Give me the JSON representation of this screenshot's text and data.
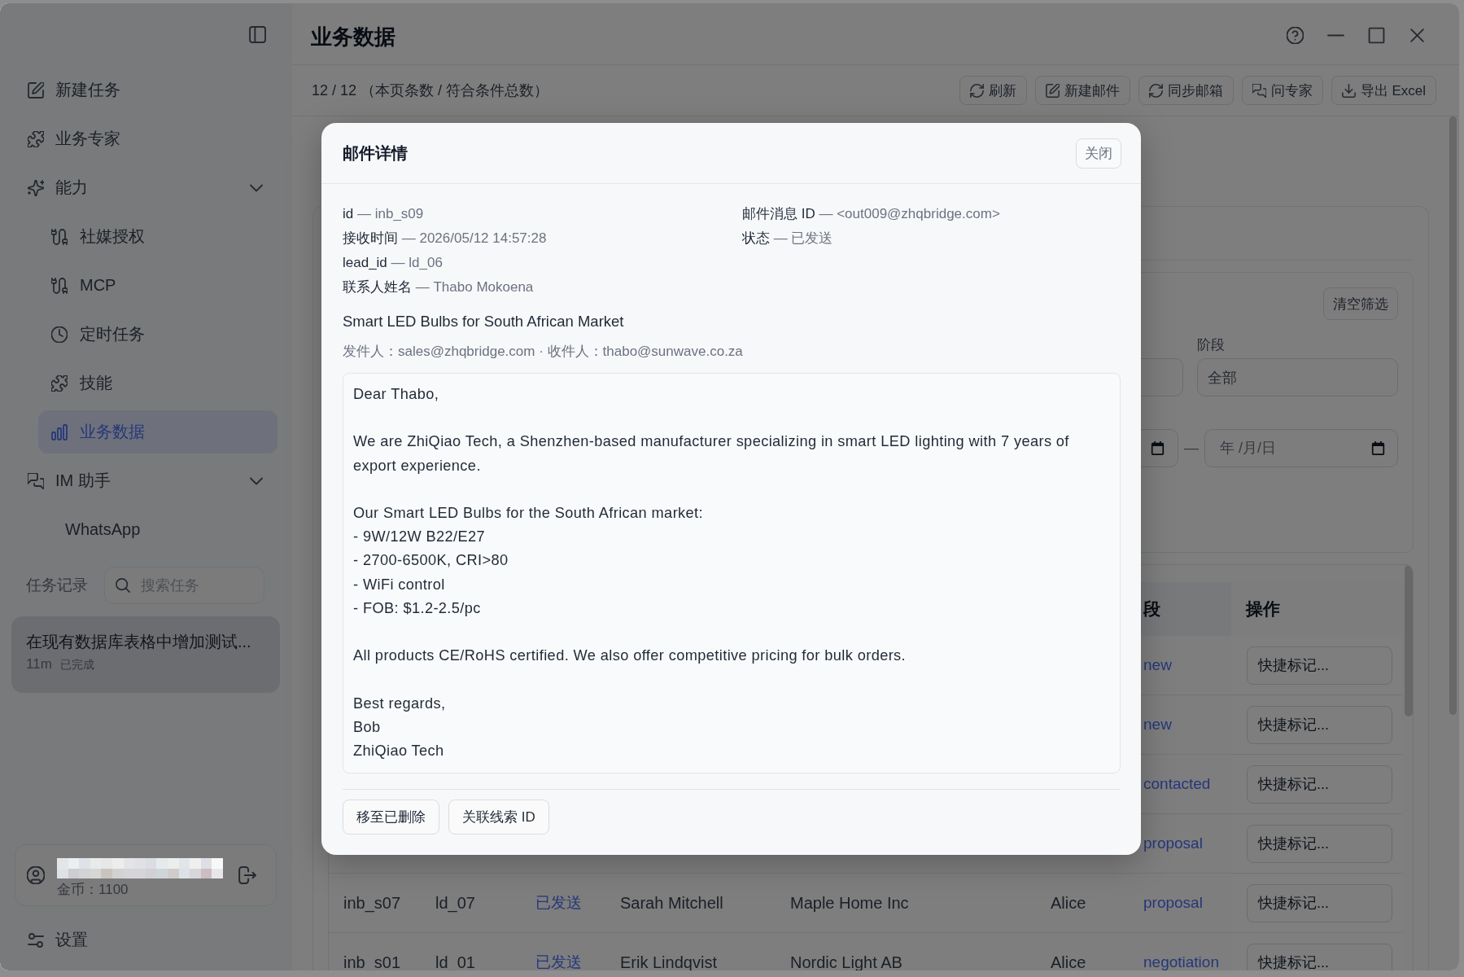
{
  "window": {
    "title": "业务数据"
  },
  "sidebar": {
    "items": [
      {
        "label": "新建任务",
        "selected": false
      },
      {
        "label": "业务专家",
        "selected": false
      },
      {
        "label": "能力",
        "selected": false,
        "expanded": true,
        "children": [
          {
            "label": "社媒授权",
            "selected": false
          },
          {
            "label": "MCP",
            "selected": false
          },
          {
            "label": "定时任务",
            "selected": false
          },
          {
            "label": "技能",
            "selected": false
          },
          {
            "label": "业务数据",
            "selected": true
          }
        ]
      },
      {
        "label": "IM 助手",
        "selected": false,
        "expanded": true,
        "children": [
          {
            "label": "WhatsApp",
            "selected": false
          }
        ]
      }
    ],
    "task_history": {
      "label": "任务记录",
      "search": {
        "placeholder": "搜索任务"
      },
      "tasks": [
        {
          "title": "在现有数据库表格中增加测试...",
          "age": "11m",
          "status": "已完成",
          "selected": true
        }
      ]
    },
    "account": {
      "coins": "金币：1100"
    },
    "settings": {
      "label": "设置"
    }
  },
  "toolbar": {
    "summary": "12 / 12 （本页条数 / 符合条件总数）",
    "buttons": [
      {
        "label": "刷新"
      },
      {
        "label": "新建邮件"
      },
      {
        "label": "同步邮箱"
      },
      {
        "label": "问专家"
      },
      {
        "label": "导出 Excel"
      }
    ]
  },
  "filters": {
    "clear_button": "清空筛选",
    "stage": {
      "label": "阶段",
      "value": "全部"
    },
    "date_separator": "—",
    "date_end": {
      "placeholder": "年 /月/日"
    }
  },
  "table": {
    "columns": [
      {
        "label": "段"
      },
      {
        "label": "操作"
      }
    ],
    "rows": [
      {
        "stage": "new",
        "action": "快捷标记..."
      },
      {
        "stage": "new",
        "action": "快捷标记..."
      },
      {
        "stage": "contacted",
        "action": "快捷标记..."
      },
      {
        "stage": "proposal",
        "action": "快捷标记..."
      },
      {
        "column_1": "inb_s07",
        "column_2": "ld_07",
        "column_3": "已发送",
        "column_4": "Sarah Mitchell",
        "column_5": "Maple Home Inc",
        "column_6": "Alice",
        "stage": "proposal",
        "action": "快捷标记..."
      },
      {
        "column_1": "inb_s01",
        "column_2": "ld_01",
        "column_3": "已发送",
        "column_4": "Erik Lindqvist",
        "column_5": "Nordic Light AB",
        "column_6": "Alice",
        "stage": "negotiation",
        "action": "快捷标记..."
      }
    ]
  },
  "email_dialog": {
    "title": "邮件详情",
    "close_button": "关闭",
    "separator": "—",
    "field_columns": [
      [
        {
          "label": "id",
          "value": "inb_s09"
        },
        {
          "label": "接收时间",
          "value": "2026/05/12 14:57:28"
        },
        {
          "label": "lead_id",
          "value": "ld_06"
        },
        {
          "label": "联系人姓名",
          "value": "Thabo Mokoena"
        }
      ],
      [
        {
          "label": "邮件消息 ID",
          "value": "<out009@zhqbridge.com>"
        },
        {
          "label": "状态",
          "value": "已发送"
        }
      ]
    ],
    "subject": "Smart LED Bulbs for South African Market",
    "addresses": "发件人：sales@zhqbridge.com · 收件人：thabo@sunwave.co.za",
    "body": "Dear Thabo,\n\nWe are ZhiQiao Tech, a Shenzhen-based manufacturer specializing in smart LED lighting with 7 years of export experience.\n\nOur Smart LED Bulbs for the South African market:\n- 9W/12W B22/E27\n- 2700-6500K, CRI>80\n- WiFi control\n- FOB: $1.2-2.5/pc\n\nAll products CE/RoHS certified. We also offer competitive pricing for bulk orders.\n\nBest regards,\nBob\nZhiQiao Tech",
    "buttons": [
      {
        "label": "移至已删除"
      },
      {
        "label": "关联线索 ID"
      }
    ]
  }
}
